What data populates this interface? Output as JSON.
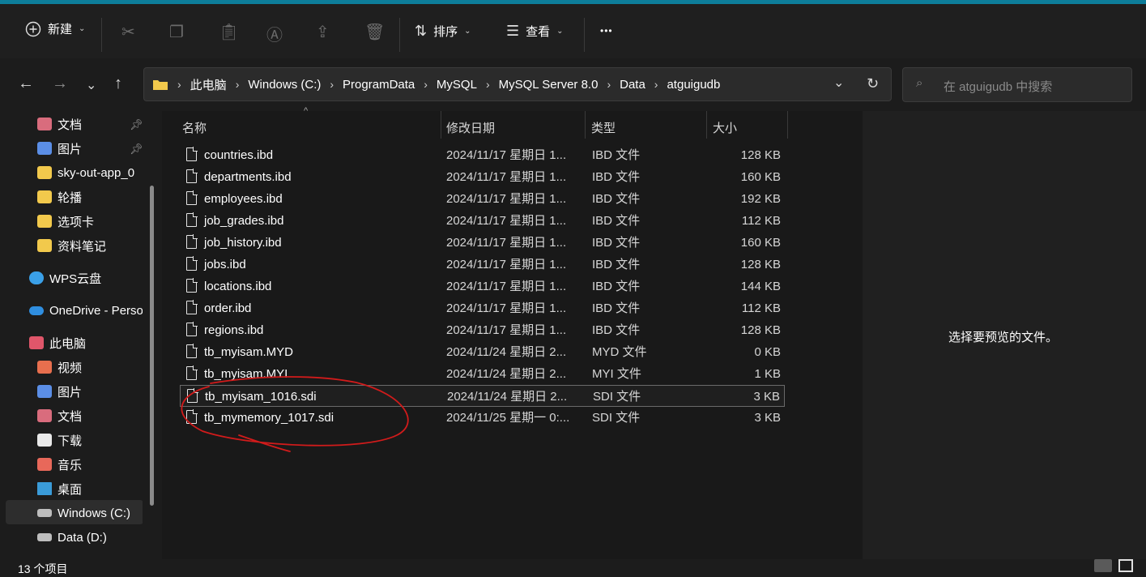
{
  "toolbar": {
    "new_label": "新建",
    "sort_label": "排序",
    "view_label": "查看",
    "more_label": "•••"
  },
  "address": {
    "crumbs": [
      "此电脑",
      "Windows (C:)",
      "ProgramData",
      "MySQL",
      "MySQL Server 8.0",
      "Data",
      "atguigudb"
    ],
    "search_placeholder": "在 atguigudb 中搜索"
  },
  "sidebar": {
    "items": [
      {
        "label": "文档",
        "icon": "documents-icon",
        "pinned": true
      },
      {
        "label": "图片",
        "icon": "pictures-icon",
        "pinned": true
      },
      {
        "label": "sky-out-app_0",
        "icon": "folder-icon"
      },
      {
        "label": "轮播",
        "icon": "folder-icon"
      },
      {
        "label": "选项卡",
        "icon": "folder-icon"
      },
      {
        "label": "资料笔记",
        "icon": "folder-icon"
      },
      {
        "label": "WPS云盘",
        "icon": "wps-cloud-icon"
      },
      {
        "label": "OneDrive - Perso",
        "icon": "onedrive-icon"
      },
      {
        "label": "此电脑",
        "icon": "this-pc-icon"
      },
      {
        "label": "视频",
        "icon": "videos-icon"
      },
      {
        "label": "图片",
        "icon": "pictures-icon"
      },
      {
        "label": "文档",
        "icon": "documents-icon"
      },
      {
        "label": "下载",
        "icon": "downloads-icon"
      },
      {
        "label": "音乐",
        "icon": "music-icon"
      },
      {
        "label": "桌面",
        "icon": "desktop-icon"
      },
      {
        "label": "Windows (C:)",
        "icon": "drive-c-icon"
      },
      {
        "label": "Data (D:)",
        "icon": "drive-d-icon"
      }
    ]
  },
  "columns": [
    "名称",
    "修改日期",
    "类型",
    "大小"
  ],
  "files": [
    {
      "name": "countries.ibd",
      "date": "2024/11/17 星期日 1...",
      "type": "IBD 文件",
      "size": "128 KB"
    },
    {
      "name": "departments.ibd",
      "date": "2024/11/17 星期日 1...",
      "type": "IBD 文件",
      "size": "160 KB"
    },
    {
      "name": "employees.ibd",
      "date": "2024/11/17 星期日 1...",
      "type": "IBD 文件",
      "size": "192 KB"
    },
    {
      "name": "job_grades.ibd",
      "date": "2024/11/17 星期日 1...",
      "type": "IBD 文件",
      "size": "112 KB"
    },
    {
      "name": "job_history.ibd",
      "date": "2024/11/17 星期日 1...",
      "type": "IBD 文件",
      "size": "160 KB"
    },
    {
      "name": "jobs.ibd",
      "date": "2024/11/17 星期日 1...",
      "type": "IBD 文件",
      "size": "128 KB"
    },
    {
      "name": "locations.ibd",
      "date": "2024/11/17 星期日 1...",
      "type": "IBD 文件",
      "size": "144 KB"
    },
    {
      "name": "order.ibd",
      "date": "2024/11/17 星期日 1...",
      "type": "IBD 文件",
      "size": "112 KB"
    },
    {
      "name": "regions.ibd",
      "date": "2024/11/17 星期日 1...",
      "type": "IBD 文件",
      "size": "128 KB"
    },
    {
      "name": "tb_myisam.MYD",
      "date": "2024/11/24 星期日 2...",
      "type": "MYD 文件",
      "size": "0 KB"
    },
    {
      "name": "tb_myisam.MYI",
      "date": "2024/11/24 星期日 2...",
      "type": "MYI 文件",
      "size": "1 KB"
    },
    {
      "name": "tb_myisam_1016.sdi",
      "date": "2024/11/24 星期日 2...",
      "type": "SDI 文件",
      "size": "3 KB",
      "selected": true
    },
    {
      "name": "tb_mymemory_1017.sdi",
      "date": "2024/11/25 星期一 0:...",
      "type": "SDI 文件",
      "size": "3 KB"
    }
  ],
  "preview_text": "选择要预览的文件。",
  "status": {
    "count": "13 个项目"
  },
  "colors": {
    "accent_bar": "#0d7d9a",
    "annotation": "#d11b1b",
    "folder": "#f2c94c"
  }
}
